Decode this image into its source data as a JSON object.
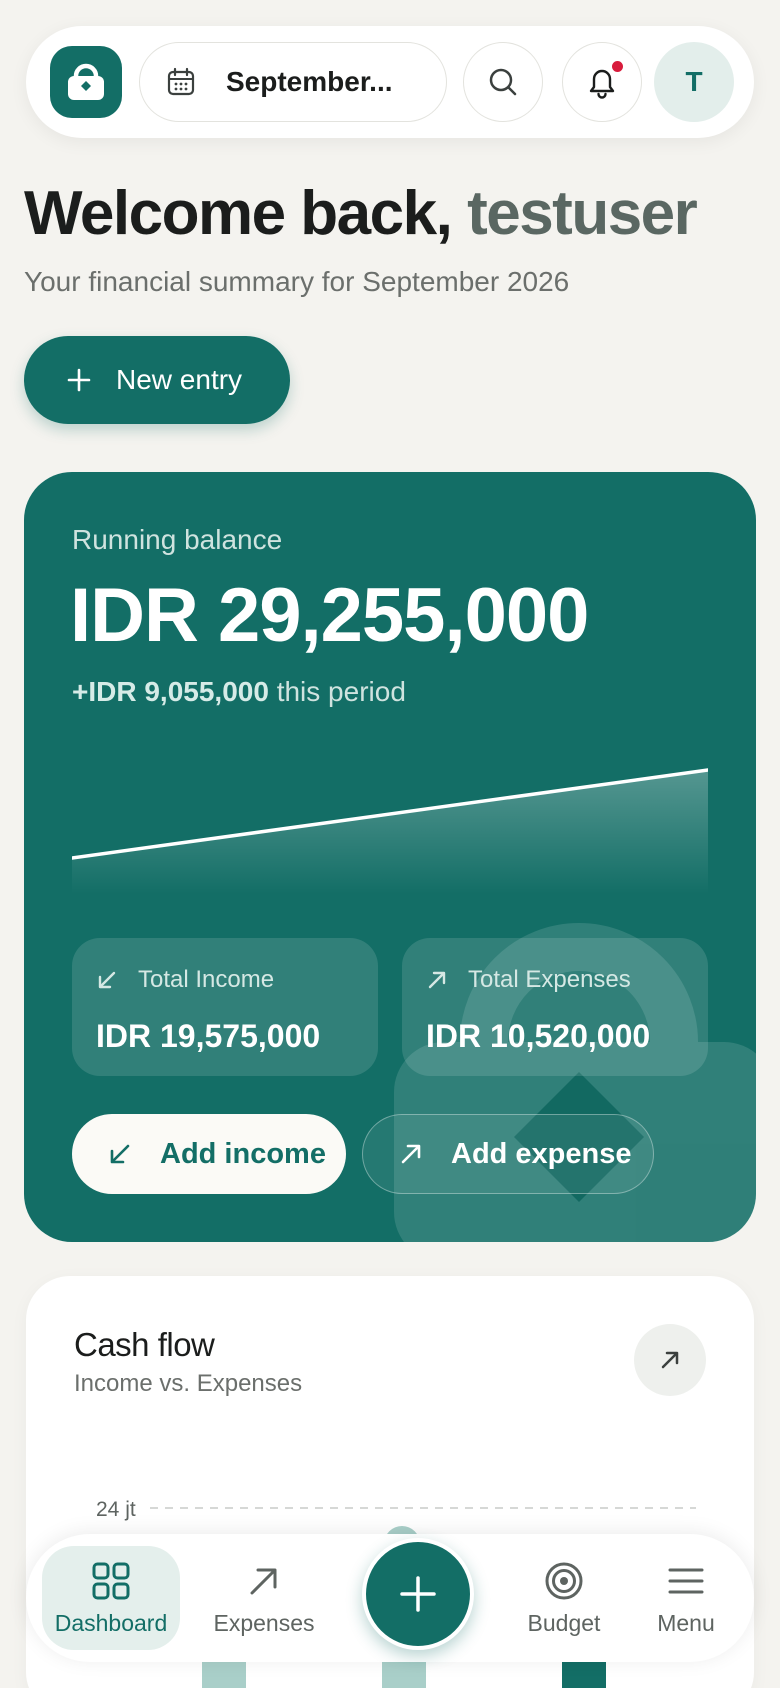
{
  "header": {
    "period_label": "September...",
    "avatar_initial": "T"
  },
  "welcome": {
    "greeting": "Welcome back, ",
    "username": "testuser",
    "subtitle": "Your financial summary for September 2026"
  },
  "actions": {
    "new_entry": "New entry"
  },
  "balance": {
    "label": "Running balance",
    "amount": "IDR 29,255,000",
    "delta_amount": "+IDR 9,055,000",
    "delta_suffix": " this period",
    "income_label": "Total Income",
    "income_value": "IDR 19,575,000",
    "expense_label": "Total Expenses",
    "expense_value": "IDR 10,520,000",
    "add_income": "Add income",
    "add_expense": "Add expense"
  },
  "cashflow": {
    "title": "Cash flow",
    "subtitle": "Income vs. Expenses",
    "y_tick_top": "24 jt"
  },
  "nav": {
    "dashboard": "Dashboard",
    "expenses": "Expenses",
    "budget": "Budget",
    "menu": "Menu",
    "active": "Dashboard"
  },
  "colors": {
    "brand": "#136e66",
    "background": "#f4f3ef",
    "notification": "#d81c3c"
  },
  "icons": {
    "logo": "wallet-lock-icon",
    "period": "calendar-icon",
    "search": "search-icon",
    "notifications": "bell-icon",
    "new_entry": "plus-icon",
    "income": "arrow-down-left-icon",
    "expense": "arrow-up-right-icon",
    "cashflow_open": "arrow-up-right-icon",
    "dashboard": "grid-icon",
    "budget": "target-icon",
    "menu": "hamburger-icon",
    "fab": "plus-icon"
  }
}
